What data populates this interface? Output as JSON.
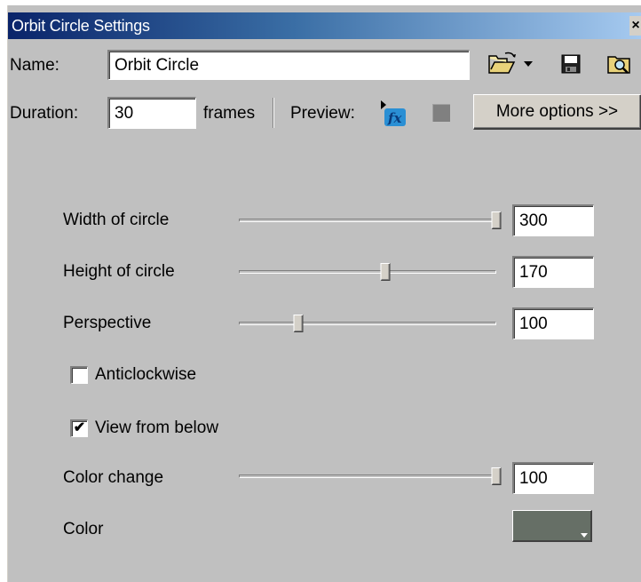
{
  "window": {
    "title": "Orbit Circle Settings",
    "close_glyph": "×"
  },
  "header": {
    "name_label": "Name:",
    "name_value": "Orbit Circle",
    "duration_label": "Duration:",
    "duration_value": "30",
    "frames_label": "frames",
    "preview_label": "Preview:",
    "more_options_label": "More options >>"
  },
  "toolbar_icons": [
    "open-folder-icon",
    "dropdown-arrow-icon",
    "save-icon",
    "browse-icon",
    "preview-fx-icon",
    "stop-icon"
  ],
  "settings": {
    "width": {
      "label": "Width of circle",
      "value": "300",
      "fraction": 1.0
    },
    "height": {
      "label": "Height of circle",
      "value": "170",
      "fraction": 0.57
    },
    "perspective": {
      "label": "Perspective",
      "value": "100",
      "fraction": 0.23
    },
    "anticlockwise": {
      "label": "Anticlockwise",
      "checked": false
    },
    "view_from_below": {
      "label": "View from below",
      "checked": true,
      "glyph": "✔"
    },
    "color_change": {
      "label": "Color change",
      "value": "100",
      "fraction": 1.0
    },
    "color": {
      "label": "Color",
      "swatch": "#666f66"
    }
  },
  "colors": {
    "panel": "#c0c0c0",
    "titlebar_start": "#0a246a",
    "titlebar_end": "#a6caf0"
  }
}
